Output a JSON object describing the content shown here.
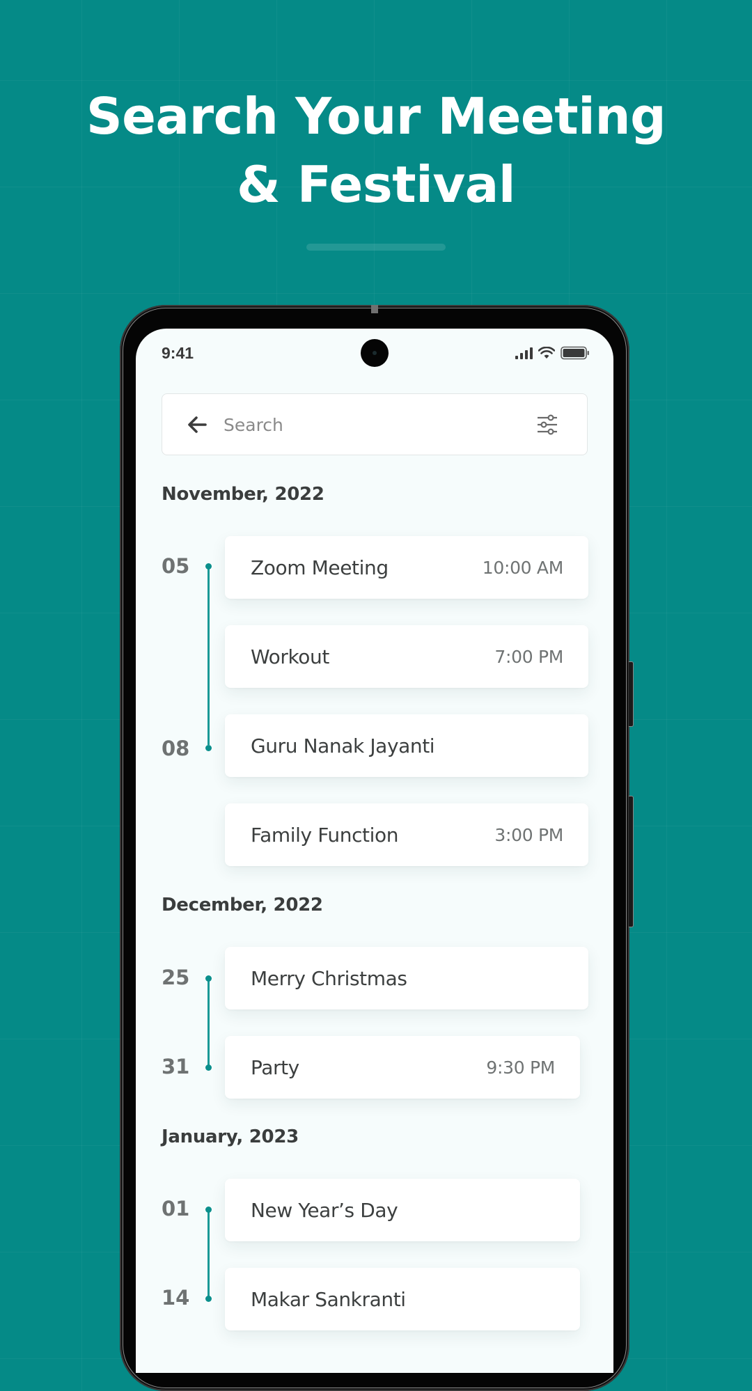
{
  "headline": {
    "line1": "Search Your Meeting",
    "line2": "& Festival"
  },
  "colors": {
    "background": "#058a87",
    "accent": "#0b8f8c",
    "screen_bg": "#f6fcfc",
    "card_bg": "#ffffff"
  },
  "status_bar": {
    "time": "9:41",
    "icons": [
      "signal-icon",
      "wifi-icon",
      "battery-icon"
    ]
  },
  "search": {
    "placeholder": "Search",
    "value": "",
    "back_icon": "arrow-left-icon",
    "filter_icon": "sliders-icon"
  },
  "sections": [
    {
      "month": "November, 2022",
      "events": [
        {
          "date": "05",
          "title": "Zoom Meeting",
          "time": "10:00 AM"
        },
        {
          "date": "",
          "title": "Workout",
          "time": "7:00 PM"
        },
        {
          "date": "08",
          "title": "Guru Nanak Jayanti",
          "time": ""
        },
        {
          "date": "",
          "title": "Family Function",
          "time": "3:00 PM"
        }
      ]
    },
    {
      "month": "December, 2022",
      "events": [
        {
          "date": "25",
          "title": "Merry Christmas",
          "time": ""
        },
        {
          "date": "31",
          "title": "Party",
          "time": "9:30 PM"
        }
      ]
    },
    {
      "month": "January, 2023",
      "events": [
        {
          "date": "01",
          "title": "New Year’s Day",
          "time": ""
        },
        {
          "date": "14",
          "title": "Makar Sankranti",
          "time": ""
        }
      ]
    }
  ]
}
